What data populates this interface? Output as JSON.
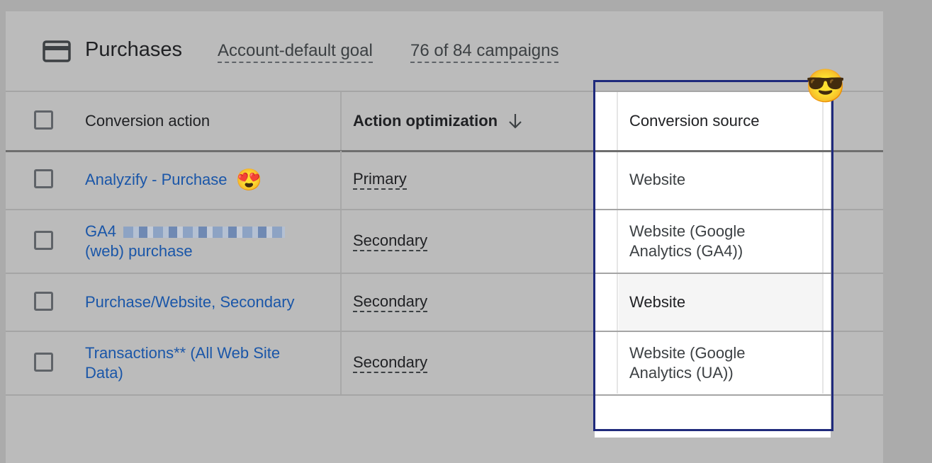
{
  "header": {
    "title": "Purchases",
    "goal_label": "Account-default goal",
    "campaigns_label": "76 of 84 campaigns",
    "icon": "credit-card-icon"
  },
  "table": {
    "columns": {
      "action": "Conversion action",
      "optimization": "Action optimization",
      "source": "Conversion source"
    },
    "sort_icon": "arrow-down-icon",
    "rows": [
      {
        "action": "Analyzify - Purchase",
        "optimization": "Primary",
        "source": "Website"
      },
      {
        "action_line1": "GA4",
        "action_line2": "(web) purchase",
        "optimization": "Secondary",
        "source_line1": "Website (Google",
        "source_line2": "Analytics (GA4))"
      },
      {
        "action": "Purchase/Website, Secondary",
        "optimization": "Secondary",
        "source": "Website"
      },
      {
        "action_line1": "Transactions** (All Web Site",
        "action_line2": "Data)",
        "optimization": "Secondary",
        "source_line1": "Website (Google",
        "source_line2": "Analytics (UA))"
      }
    ]
  },
  "annotations": {
    "highlight_color": "#1f2a7c",
    "emoji_cool": "😎",
    "emoji_heart_eyes": "😍"
  }
}
